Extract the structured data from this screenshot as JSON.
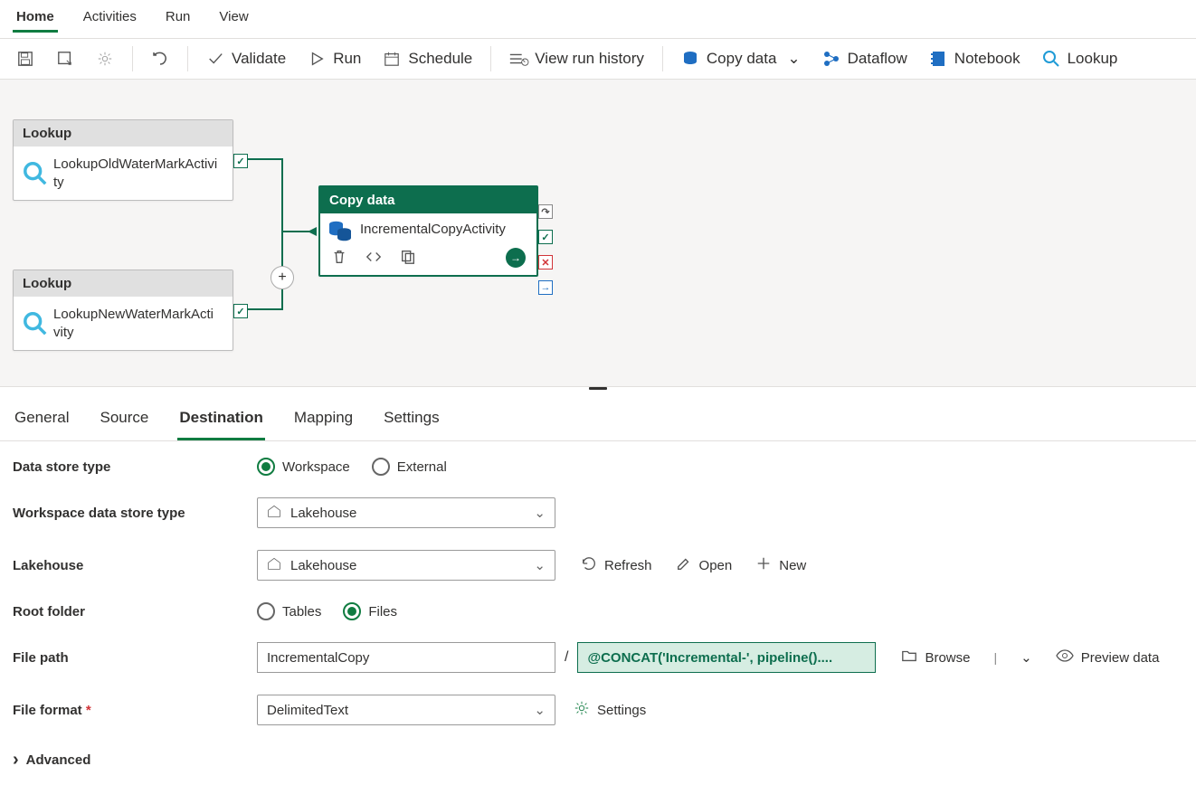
{
  "ribbon": {
    "tabs": [
      "Home",
      "Activities",
      "Run",
      "View"
    ],
    "active": 0
  },
  "toolbar": {
    "validate": "Validate",
    "run": "Run",
    "schedule": "Schedule",
    "view_run_history": "View run history",
    "copy_data": "Copy data",
    "dataflow": "Dataflow",
    "notebook": "Notebook",
    "lookup": "Lookup"
  },
  "canvas": {
    "nodes": {
      "lookup1": {
        "type": "Lookup",
        "name": "LookupOldWaterMarkActivity"
      },
      "lookup2": {
        "type": "Lookup",
        "name": "LookupNewWaterMarkActivity"
      },
      "copy": {
        "type": "Copy data",
        "name": "IncrementalCopyActivity"
      }
    }
  },
  "prop_tabs": [
    "General",
    "Source",
    "Destination",
    "Mapping",
    "Settings"
  ],
  "prop_active": 2,
  "form": {
    "data_store_type": {
      "label": "Data store type",
      "option_workspace": "Workspace",
      "option_external": "External",
      "selected": "Workspace"
    },
    "workspace_data_store_type": {
      "label": "Workspace data store type",
      "value": "Lakehouse"
    },
    "lakehouse": {
      "label": "Lakehouse",
      "value": "Lakehouse",
      "refresh": "Refresh",
      "open": "Open",
      "new": "New"
    },
    "root_folder": {
      "label": "Root folder",
      "option_tables": "Tables",
      "option_files": "Files",
      "selected": "Files"
    },
    "file_path": {
      "label": "File path",
      "folder": "IncrementalCopy",
      "expression": "@CONCAT('Incremental-', pipeline()....",
      "browse": "Browse",
      "preview": "Preview data"
    },
    "file_format": {
      "label": "File format",
      "required": true,
      "value": "DelimitedText",
      "settings": "Settings"
    },
    "advanced": "Advanced"
  }
}
